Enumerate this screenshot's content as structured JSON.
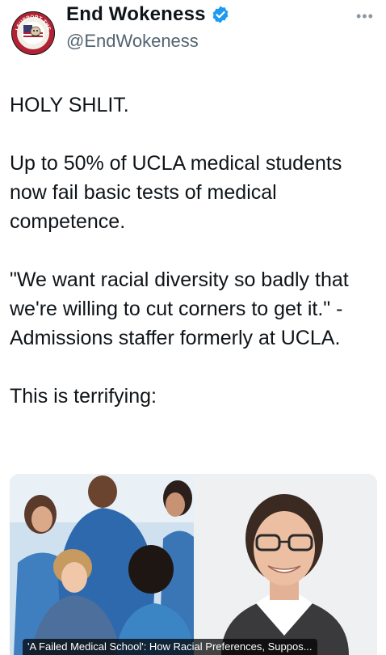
{
  "author": {
    "display_name": "End Wokeness",
    "handle": "@EndWokeness",
    "avatar_text_top": "I SUPPORT THE",
    "avatar_text_bottom": "FORMER THING"
  },
  "tweet": {
    "paragraphs": [
      "HOLY SHLIT.",
      "Up to 50% of UCLA medical students now fail basic tests of medical competence.",
      "\"We want racial diversity so badly that we're willing to cut corners to get it.\" - Admissions staffer formerly at UCLA.",
      "This is terrifying:"
    ]
  },
  "card": {
    "caption": "'A Failed Medical School': How Racial Preferences, Suppos..."
  },
  "colors": {
    "verified": "#1d9bf0",
    "text": "#0f1419",
    "secondary": "#536471"
  }
}
